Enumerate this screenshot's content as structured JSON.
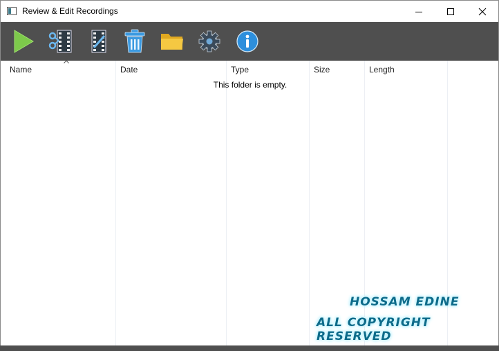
{
  "window": {
    "title": "Review & Edit Recordings"
  },
  "window_controls": {
    "minimize": "—",
    "maximize": "☐",
    "close": "✕"
  },
  "toolbar": {
    "items": [
      {
        "name": "play-icon"
      },
      {
        "name": "trim-video-icon"
      },
      {
        "name": "edit-video-icon"
      },
      {
        "name": "trash-icon"
      },
      {
        "name": "folder-icon"
      },
      {
        "name": "gear-icon"
      },
      {
        "name": "info-icon"
      }
    ]
  },
  "list": {
    "columns": [
      "Name",
      "Date",
      "Type",
      "Size",
      "Length"
    ],
    "sort_column": "Name",
    "empty_message": "This folder is empty."
  },
  "watermark": {
    "line1": "HOSSAM EDINE",
    "line2": "ALL COPYRIGHT RESERVED"
  },
  "colors": {
    "toolbar": "#4f4f4f",
    "play": "#7dc94b",
    "trash": "#3b9ae1",
    "folder": "#f2c230",
    "info": "#2d8fdc"
  }
}
